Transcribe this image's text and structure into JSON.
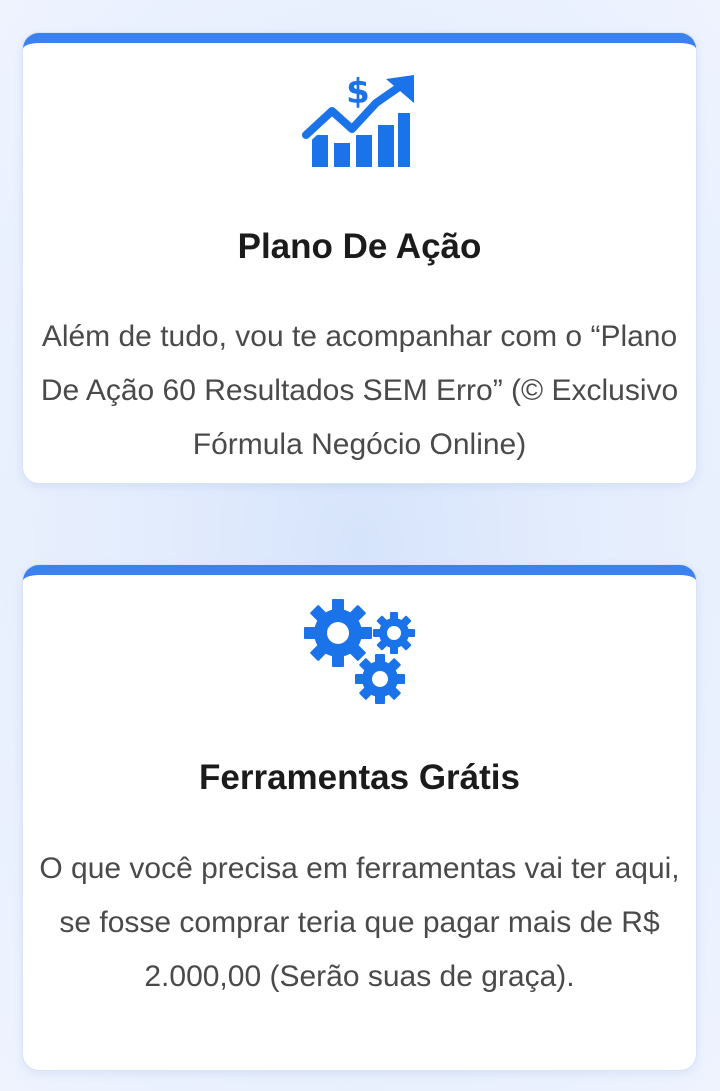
{
  "colors": {
    "accent": "#3b82f0",
    "icon": "#1a73e8",
    "title": "#1b1b1b",
    "text": "#4a4a4a"
  },
  "cards": [
    {
      "icon": "dollar-growth-chart-icon",
      "title": "Plano De Ação",
      "text": "Além de tudo, vou te acompanhar com o “Plano De Ação 60 Resultados SEM Erro” (© Exclusivo Fórmula Negócio Online)"
    },
    {
      "icon": "gears-icon",
      "title": "Ferramentas Grátis",
      "text": "O que você precisa em ferramentas vai ter aqui, se fosse comprar teria que pagar mais de R$ 2.000,00 (Serão suas de graça)."
    }
  ]
}
